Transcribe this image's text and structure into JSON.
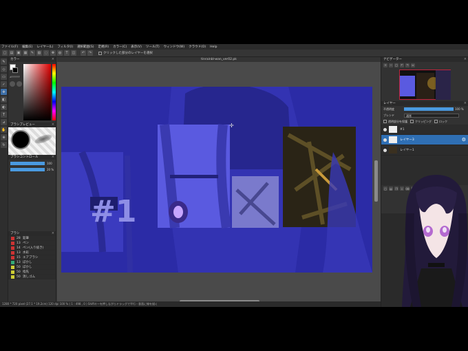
{
  "menu": [
    "ファイル(F)",
    "編集(E)",
    "レイヤー(L)",
    "フィルタ(I)",
    "選択範囲(S)",
    "定規(R)",
    "カラー(C)",
    "表示(V)",
    "ツール(T)",
    "ウィンドウ(W)",
    "クラウド(O)",
    "Help"
  ],
  "toolbar": {
    "checkbox_label": "クリックした部分のレイヤーを選択"
  },
  "document": {
    "filename": "tinrainbl-wan_ver02.pk"
  },
  "panels": {
    "color": "カラー",
    "brush_preview": "ブラシプレビュー",
    "brush_control": "ブラシコントロール",
    "brush": "ブラシ",
    "navigator": "ナビゲーター",
    "layer": "レイヤー"
  },
  "color": {
    "hex": "#FFFFFF"
  },
  "brush_control": {
    "size": "100",
    "opacity": "20 %"
  },
  "brushes": [
    {
      "size": "28",
      "name": "鉛筆",
      "color": "#c33"
    },
    {
      "size": "13",
      "name": "ペン",
      "color": "#c33"
    },
    {
      "size": "14",
      "name": "ペン(入り抜き)",
      "color": "#c33"
    },
    {
      "size": "13",
      "name": "水彩",
      "color": "#c33"
    },
    {
      "size": "15",
      "name": "エアブラシ",
      "color": "#c33"
    },
    {
      "size": "13",
      "name": "ぼかし",
      "color": "#3a7"
    },
    {
      "size": "50",
      "name": "ぼかし",
      "color": "#cc3"
    },
    {
      "size": "50",
      "name": "指先",
      "color": "#cc3"
    },
    {
      "size": "50",
      "name": "消しゴム",
      "color": "#cc3"
    }
  ],
  "layer_panel": {
    "opacity_label": "不透明度",
    "opacity_value": "100 %",
    "blend_label": "ブレンド",
    "blend_value": "通常",
    "checks": [
      "透明部分を保護",
      "クリッピング",
      "ロック"
    ],
    "layers": [
      {
        "name": "#1",
        "selected": false
      },
      {
        "name": "レイヤー3",
        "selected": true
      },
      {
        "name": "レイヤー1",
        "selected": false
      }
    ]
  },
  "art": {
    "overlay_text": "#1"
  },
  "status": {
    "text": "1280 * 720 pixel  (27.1 * 19.2cm)  120 dpi  100 %  ( 1 : 498 , 0 )  Shiftキーを押しながらドラッグで平行・垂直に線を描く"
  }
}
